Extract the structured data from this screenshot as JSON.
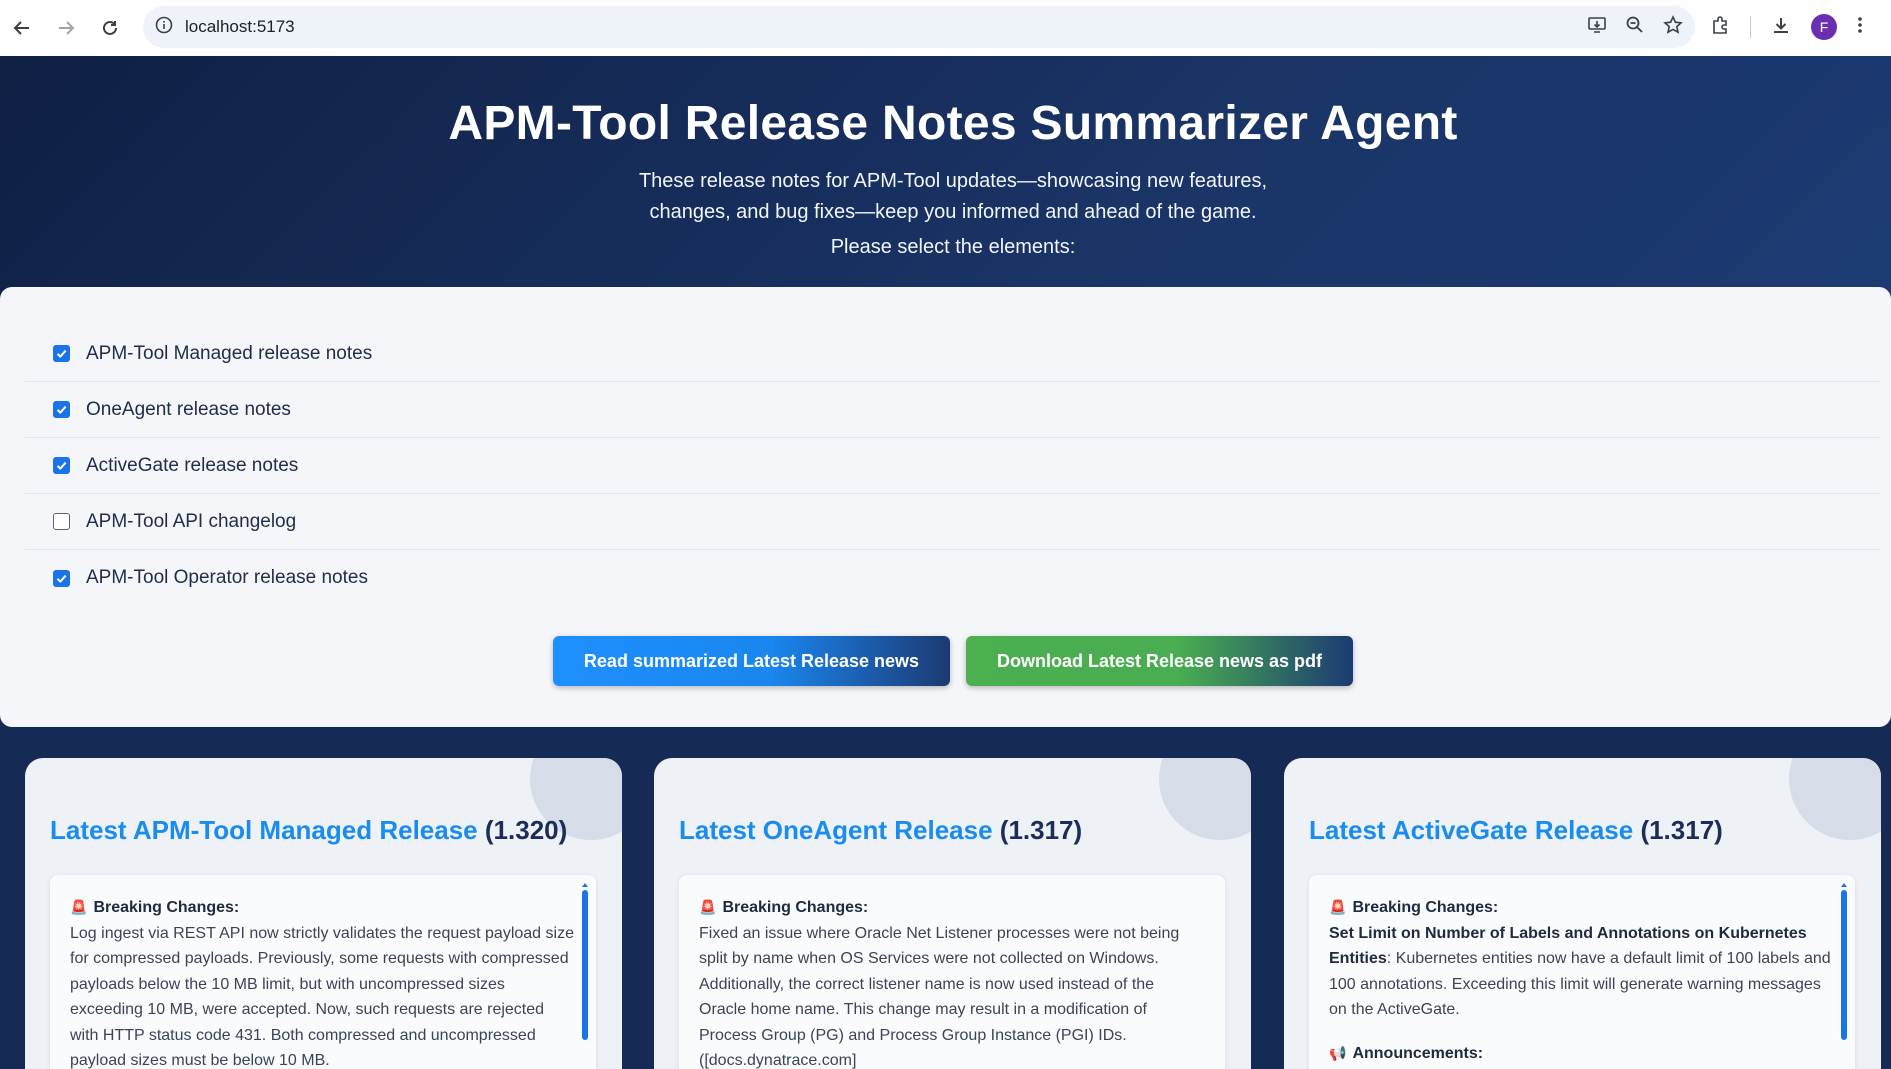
{
  "browser": {
    "url": "localhost:5173",
    "profile_initial": "F"
  },
  "hero": {
    "title": "APM-Tool Release Notes Summarizer Agent",
    "description_line1": "These release notes for APM-Tool updates—showcasing new features,",
    "description_line2": "changes, and bug fixes—keep you informed and ahead of the game.",
    "prompt": "Please select the elements:"
  },
  "options": [
    {
      "label": "APM-Tool Managed release notes",
      "checked": true
    },
    {
      "label": "OneAgent release notes",
      "checked": true
    },
    {
      "label": "ActiveGate release notes",
      "checked": true
    },
    {
      "label": "APM-Tool API changelog",
      "checked": false
    },
    {
      "label": "APM-Tool Operator release notes",
      "checked": true
    }
  ],
  "buttons": {
    "read_label": "Read summarized Latest Release news",
    "pdf_label": "Download Latest Release news as pdf"
  },
  "cards": [
    {
      "title_highlight": "Latest APM-Tool Managed Release",
      "version": "(1.320)",
      "breaking_title": "Breaking Changes:",
      "body": "Log ingest via REST API now strictly validates the request payload size for compressed payloads. Previously, some requests with compressed payloads below the 10 MB limit, but with uncompressed sizes exceeding 10 MB, were accepted. Now, such requests are rejected with HTTP status code 431. Both compressed and uncompressed payload sizes must be below 10 MB."
    },
    {
      "title_highlight": "Latest OneAgent Release",
      "version": "(1.317)",
      "breaking_title": "Breaking Changes:",
      "body": "Fixed an issue where Oracle Net Listener processes were not being split by name when OS Services were not collected on Windows. Additionally, the correct listener name is now used instead of the Oracle home name. This change may result in a modification of Process Group (PG) and Process Group Instance (PGI) IDs. ([docs.dynatrace.com]"
    },
    {
      "title_highlight": "Latest ActiveGate Release",
      "version": "(1.317)",
      "breaking_title": "Breaking Changes:",
      "body_bold": "Set Limit on Number of Labels and Annotations on Kubernetes Entities",
      "body": ": Kubernetes entities now have a default limit of 100 labels and 100 annotations. Exceeding this limit will generate warning messages on the ActiveGate.",
      "announce_title": "Announcements:"
    }
  ],
  "icons": {
    "breaking": "siren-emoji",
    "announce": "megaphone-emoji"
  },
  "colors": {
    "accent_blue": "#1a8cef",
    "navy": "#152a55",
    "green": "#4caf50"
  }
}
